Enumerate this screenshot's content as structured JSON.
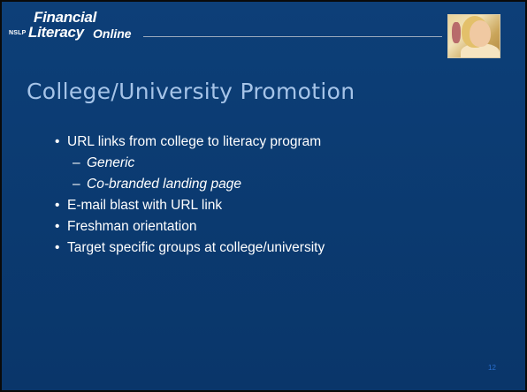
{
  "logo": {
    "line1": "Financial",
    "nslp": "NSLP",
    "line2": "Literacy",
    "line3": "Online"
  },
  "title": "College/University Promotion",
  "bullets": [
    {
      "level": 1,
      "marker": "•",
      "text": "URL links from college to literacy program"
    },
    {
      "level": 2,
      "marker": "–",
      "text": "Generic"
    },
    {
      "level": 2,
      "marker": "–",
      "text": "Co-branded landing page"
    },
    {
      "level": 1,
      "marker": "•",
      "text": "E-mail blast with URL link"
    },
    {
      "level": 1,
      "marker": "•",
      "text": "Freshman orientation"
    },
    {
      "level": 1,
      "marker": "•",
      "text": "Target specific groups at college/university"
    }
  ],
  "page_number": "12",
  "colors": {
    "background": "#0b3a70",
    "title": "#a6c4e8",
    "body_text": "#ffffff",
    "page_number": "#2a6fd0"
  }
}
